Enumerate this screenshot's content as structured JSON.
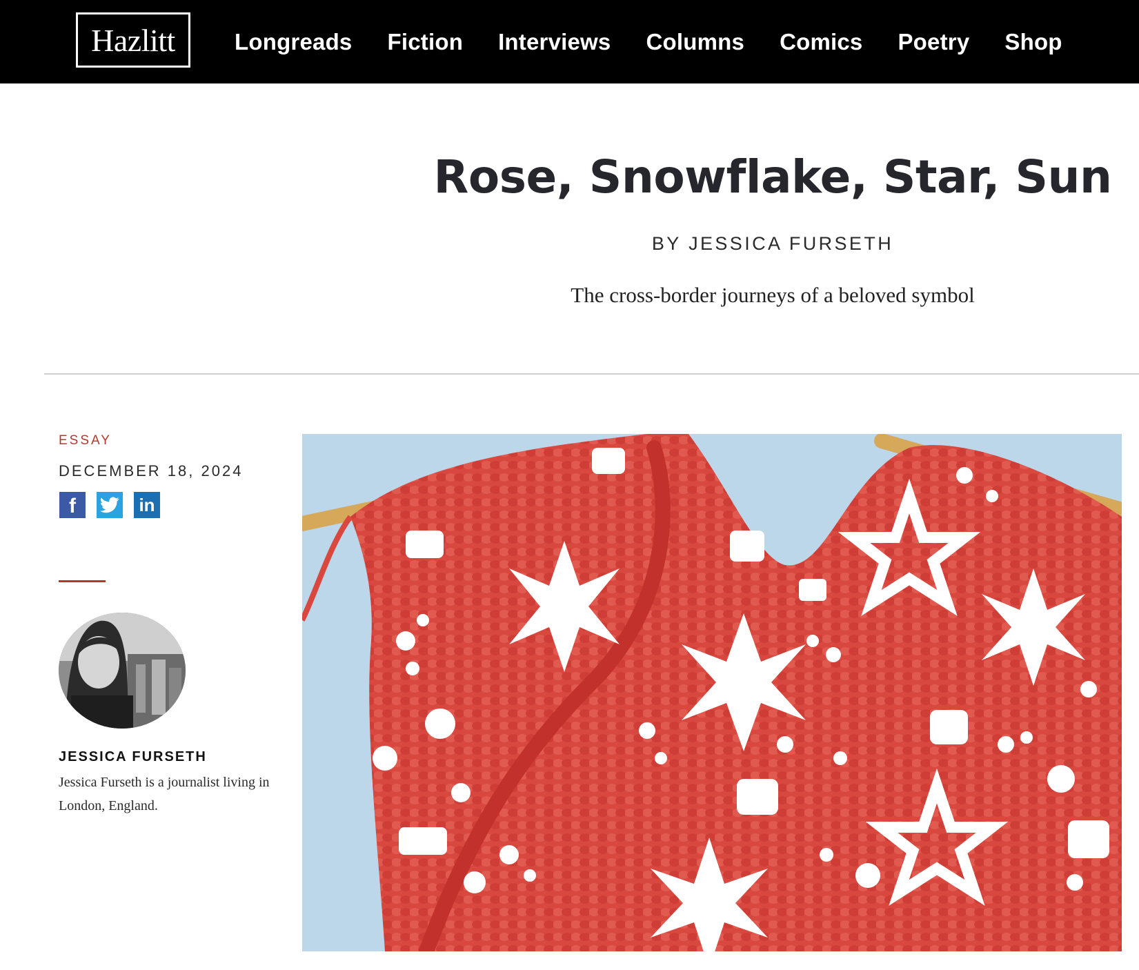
{
  "site": {
    "logo_text": "Hazlitt",
    "nav": [
      "Longreads",
      "Fiction",
      "Interviews",
      "Columns",
      "Comics",
      "Poetry",
      "Shop"
    ]
  },
  "article": {
    "title": "Rose, Snowflake, Star, Sun",
    "byline": "BY JESSICA FURSETH",
    "dek": "The cross-border journeys of a beloved symbol",
    "category": "ESSAY",
    "date": "DECEMBER 18, 2024"
  },
  "share": {
    "facebook_glyph": "f",
    "linkedin_glyph": "in"
  },
  "author": {
    "name": "JESSICA FURSETH",
    "bio": "Jessica Furseth is a journalist living in London, England."
  },
  "colors": {
    "accent": "#b2392c",
    "facebook": "#3b5aa6",
    "twitter": "#2aa3e0",
    "linkedin": "#1c6fb1",
    "knit_red": "#d9483f",
    "sky": "#bcd6ea"
  },
  "icons": [
    "facebook-icon",
    "twitter-icon",
    "linkedin-icon"
  ]
}
